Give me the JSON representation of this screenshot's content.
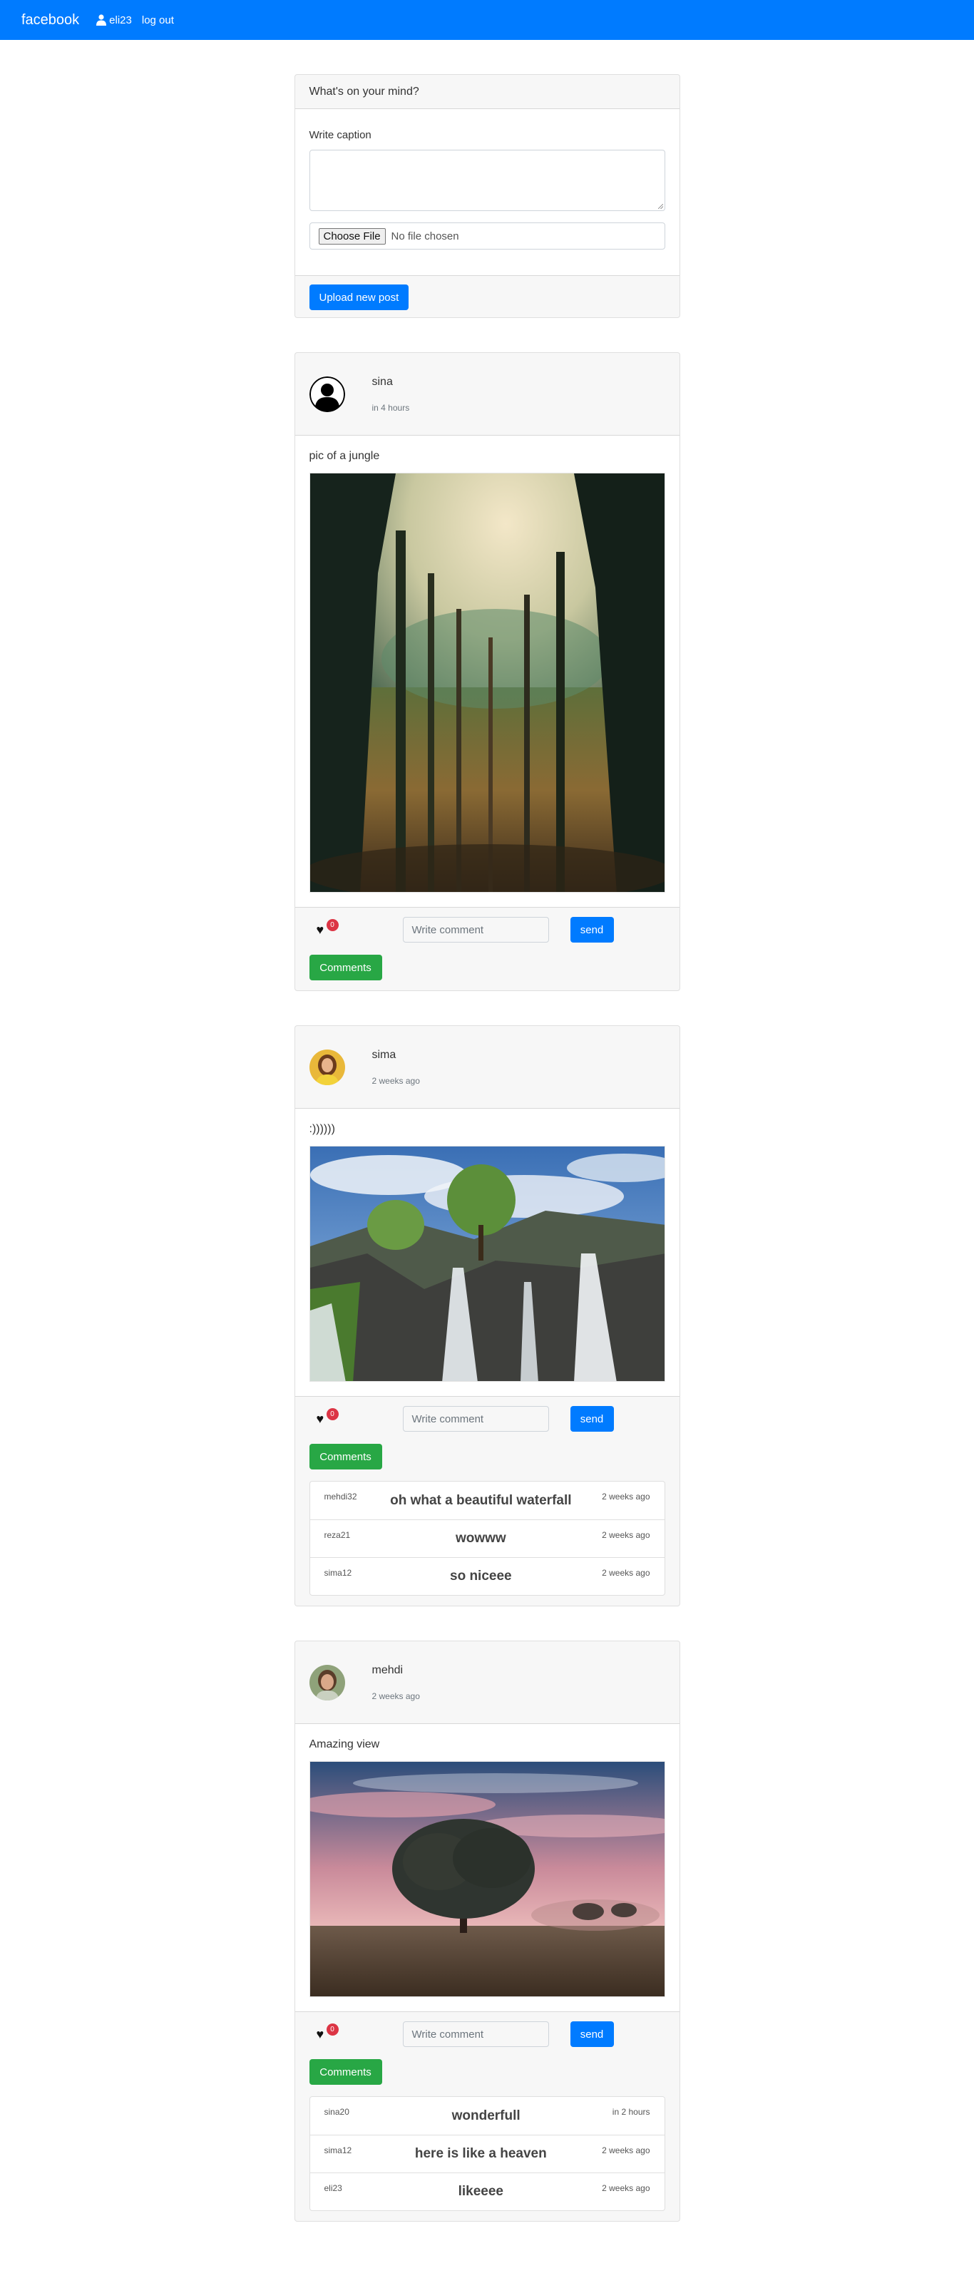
{
  "nav": {
    "brand": "facebook",
    "username": "eli23",
    "logout": "log out"
  },
  "composer": {
    "header": "What's on your mind?",
    "caption_label": "Write caption",
    "choose_file": "Choose File",
    "no_file": "No file chosen",
    "upload_button": "Upload new post"
  },
  "posts": [
    {
      "author": "sina",
      "time": "in 4 hours",
      "caption": "pic of a jungle",
      "image": "forest-photo",
      "likes": "0",
      "comment_placeholder": "Write comment",
      "send": "send",
      "comments_button": "Comments",
      "comments": []
    },
    {
      "author": "sima",
      "time": "2 weeks ago",
      "caption": ":))))))",
      "image": "waterfall-photo",
      "likes": "0",
      "comment_placeholder": "Write comment",
      "send": "send",
      "comments_button": "Comments",
      "comments": [
        {
          "user": "mehdi32",
          "text": "oh what a beautiful waterfall",
          "time": "2 weeks ago"
        },
        {
          "user": "reza21",
          "text": "wowww",
          "time": "2 weeks ago"
        },
        {
          "user": "sima12",
          "text": "so niceee",
          "time": "2 weeks ago"
        }
      ]
    },
    {
      "author": "mehdi",
      "time": "2 weeks ago",
      "caption": "Amazing view",
      "image": "tree-sunset-photo",
      "likes": "0",
      "comment_placeholder": "Write comment",
      "send": "send",
      "comments_button": "Comments",
      "comments": [
        {
          "user": "sina20",
          "text": "wonderfull",
          "time": "in 2 hours"
        },
        {
          "user": "sima12",
          "text": "here is like a heaven",
          "time": "2 weeks ago"
        },
        {
          "user": "eli23",
          "text": "likeeee",
          "time": "2 weeks ago"
        }
      ]
    }
  ],
  "colors": {
    "primary": "#007bff",
    "success": "#28a745",
    "danger": "#dc3545"
  }
}
